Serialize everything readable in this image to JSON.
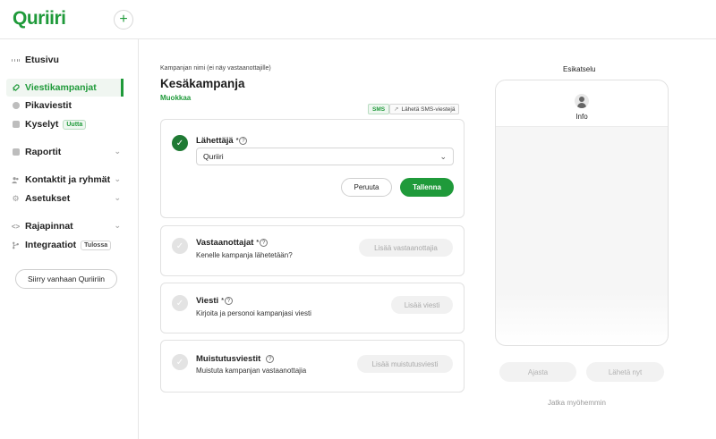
{
  "header": {
    "logo": "Quriiri",
    "new_button": "+"
  },
  "sidebar": {
    "items": [
      {
        "label": "Etusivu"
      },
      {
        "label": "Viestikampanjat"
      },
      {
        "label": "Pikaviestit"
      },
      {
        "label": "Kyselyt",
        "badge": "Uutta"
      },
      {
        "label": "Raportit"
      },
      {
        "label": "Kontaktit ja ryhmät"
      },
      {
        "label": "Asetukset"
      },
      {
        "label": "Rajapinnat"
      },
      {
        "label": "Integraatiot",
        "badge": "Tulossa"
      }
    ],
    "old_version_button": "Siirry vanhaan Quriiriin"
  },
  "campaign": {
    "name_label": "Kampanjan nimi (ei näy vastaanottajille)",
    "name": "Kesäkampanja",
    "edit_link": "Muokkaa",
    "channel_badge": "SMS",
    "send_badge": "Lähetä SMS-viestejä"
  },
  "sender_card": {
    "title": "Lähettäjä",
    "required": "*",
    "selected": "Quriiri",
    "cancel_label": "Peruuta",
    "save_label": "Tallenna"
  },
  "steps": [
    {
      "title": "Vastaanottajat",
      "required": "*",
      "subtitle": "Kenelle kampanja lähetetään?",
      "button": "Lisää vastaanottajia"
    },
    {
      "title": "Viesti",
      "required": "*",
      "subtitle": "Kirjoita ja personoi kampanjasi viesti",
      "button": "Lisää viesti"
    },
    {
      "title": "Muistutusviestit",
      "required": "",
      "subtitle": "Muistuta kampanjan vastaanottajia",
      "button": "Lisää muistutusviesti"
    }
  ],
  "preview": {
    "title": "Esikatselu",
    "sender_name": "Info",
    "schedule_button": "Ajasta",
    "send_now_button": "Lähetä nyt",
    "later_link": "Jatka myöhemmin"
  },
  "colors": {
    "brand": "#1f9a3a",
    "brand_dark": "#1f7a34"
  }
}
